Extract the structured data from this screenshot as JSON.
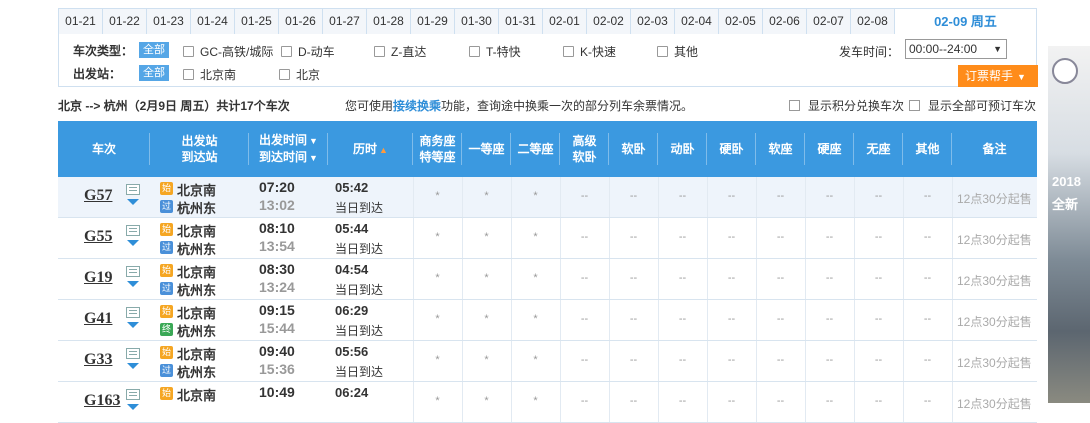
{
  "date_tabs": [
    "01-21",
    "01-22",
    "01-23",
    "01-24",
    "01-25",
    "01-26",
    "01-27",
    "01-28",
    "01-29",
    "01-30",
    "01-31",
    "02-01",
    "02-02",
    "02-03",
    "02-04",
    "02-05",
    "02-06",
    "02-07",
    "02-08"
  ],
  "active_date": "02-09 周五",
  "filters": {
    "type_label": "车次类型：",
    "station_label": "出发站：",
    "all_label": "全部",
    "types": [
      "GC-高铁/城际",
      "D-动车",
      "Z-直达",
      "T-特快",
      "K-快速",
      "其他"
    ],
    "stations": [
      "北京南",
      "北京"
    ],
    "time_label": "发车时间：",
    "time_value": "00:00--24:00",
    "help_button": "订票帮手"
  },
  "summary": {
    "route": "北京 --> 杭州（2月9日  周五）共计",
    "count": "17",
    "suffix": "个车次"
  },
  "notice": {
    "prefix": "您可使用",
    "link": "接续换乘",
    "suffix": "功能，查询途中换乘一次的部分列车余票情况。"
  },
  "options": [
    "显示积分兑换车次",
    "显示全部可预订车次"
  ],
  "headers": {
    "train": "车次",
    "from": "出发站",
    "to": "到达站",
    "dep_time": "出发时间",
    "arr_time": "到达时间",
    "duration": "历时",
    "business_1": "商务座",
    "business_2": "特等座",
    "first": "一等座",
    "second": "二等座",
    "premium_1": "高级",
    "premium_2": "软卧",
    "soft_sleeper": "软卧",
    "moving_sleeper": "动卧",
    "hard_sleeper": "硬卧",
    "soft_seat": "软座",
    "hard_seat": "硬座",
    "no_seat": "无座",
    "other": "其他",
    "remark": "备注"
  },
  "badges": {
    "start": "始",
    "pass": "过",
    "end": "终"
  },
  "rows": [
    {
      "code": "G57",
      "from": "北京南",
      "to": "杭州东",
      "to_badge": "过",
      "dep": "07:20",
      "arr": "13:02",
      "dur": "05:42",
      "arrival_day": "当日到达",
      "seats": [
        "*",
        "*",
        "*",
        "--",
        "--",
        "--",
        "--",
        "--",
        "--",
        "--",
        "--"
      ],
      "note": "12点30分起售"
    },
    {
      "code": "G55",
      "from": "北京南",
      "to": "杭州东",
      "to_badge": "过",
      "dep": "08:10",
      "arr": "13:54",
      "dur": "05:44",
      "arrival_day": "当日到达",
      "seats": [
        "*",
        "*",
        "*",
        "--",
        "--",
        "--",
        "--",
        "--",
        "--",
        "--",
        "--"
      ],
      "note": "12点30分起售"
    },
    {
      "code": "G19",
      "from": "北京南",
      "to": "杭州东",
      "to_badge": "过",
      "dep": "08:30",
      "arr": "13:24",
      "dur": "04:54",
      "arrival_day": "当日到达",
      "seats": [
        "*",
        "*",
        "*",
        "--",
        "--",
        "--",
        "--",
        "--",
        "--",
        "--",
        "--"
      ],
      "note": "12点30分起售"
    },
    {
      "code": "G41",
      "from": "北京南",
      "to": "杭州东",
      "to_badge": "终",
      "dep": "09:15",
      "arr": "15:44",
      "dur": "06:29",
      "arrival_day": "当日到达",
      "seats": [
        "*",
        "*",
        "*",
        "--",
        "--",
        "--",
        "--",
        "--",
        "--",
        "--",
        "--"
      ],
      "note": "12点30分起售"
    },
    {
      "code": "G33",
      "from": "北京南",
      "to": "杭州东",
      "to_badge": "过",
      "dep": "09:40",
      "arr": "15:36",
      "dur": "05:56",
      "arrival_day": "当日到达",
      "seats": [
        "*",
        "*",
        "*",
        "--",
        "--",
        "--",
        "--",
        "--",
        "--",
        "--",
        "--"
      ],
      "note": "12点30分起售"
    },
    {
      "code": "G163",
      "from": "北京南",
      "to": "",
      "to_badge": "",
      "dep": "10:49",
      "arr": "",
      "dur": "06:24",
      "arrival_day": "",
      "seats": [
        "*",
        "*",
        "*",
        "--",
        "--",
        "--",
        "--",
        "--",
        "--",
        "--",
        "--"
      ],
      "note": "12点30分起售"
    }
  ],
  "ad": {
    "year": "2018",
    "tagline": "全新"
  }
}
